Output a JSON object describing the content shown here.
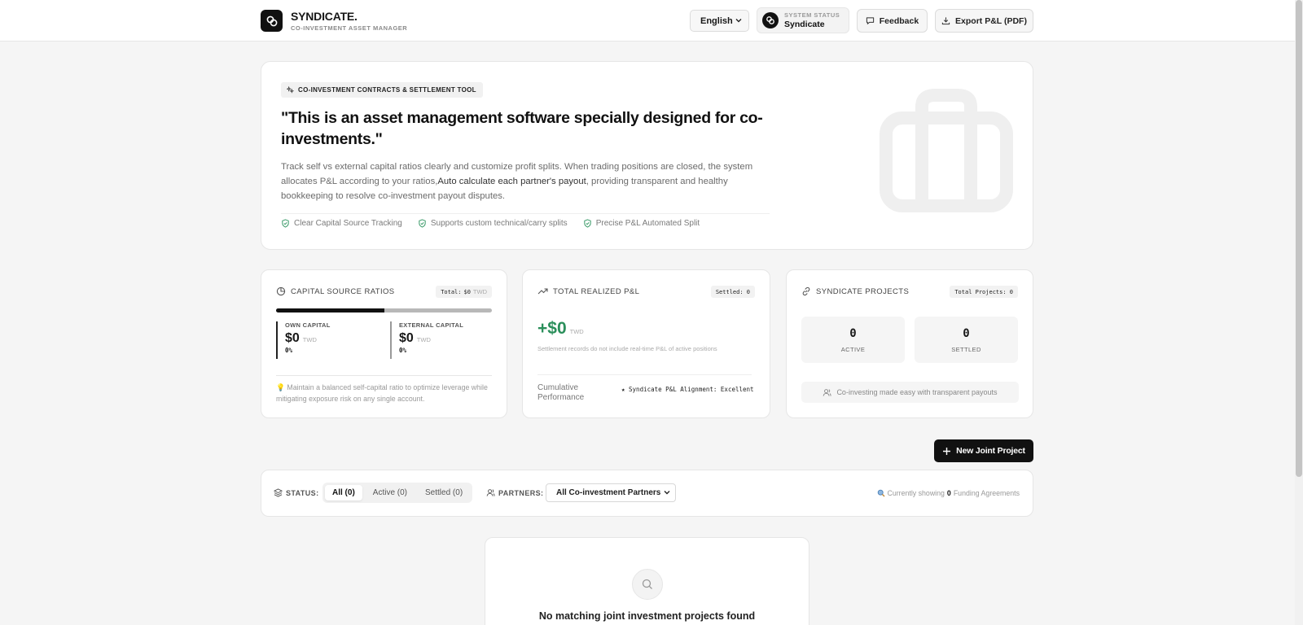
{
  "header": {
    "brand_name": "SYNDICATE.",
    "brand_sub": "CO-INVESTMENT ASSET MANAGER",
    "language": "English",
    "system_status_label": "SYSTEM STATUS",
    "system_status_value": "Syndicate",
    "feedback_label": "Feedback",
    "export_label": "Export P&L (PDF)"
  },
  "hero": {
    "badge": "CO-INVESTMENT CONTRACTS & SETTLEMENT TOOL",
    "title": "\"This is an asset management software specially designed for co-investments.\"",
    "desc_part1": "Track self vs external capital ratios clearly and customize profit splits. When trading positions are closed, the system allocates P&L according to your ratios,",
    "desc_highlight": "Auto calculate each partner's payout",
    "desc_part2": ", providing transparent and healthy bookkeeping to resolve co-investment payout disputes.",
    "features": [
      "Clear Capital Source Tracking",
      "Supports custom technical/carry splits",
      "Precise P&L Automated Split"
    ]
  },
  "capital": {
    "title": "CAPITAL SOURCE RATIOS",
    "pill_label": "Total:",
    "pill_value": "$0",
    "pill_unit": "TWD",
    "own_ratio": 0.5,
    "own_label": "OWN CAPITAL",
    "own_value": "$0",
    "own_unit": "TWD",
    "own_pct": "0%",
    "ext_label": "EXTERNAL CAPITAL",
    "ext_value": "$0",
    "ext_unit": "TWD",
    "ext_pct": "0%",
    "tip": "💡 Maintain a balanced self-capital ratio to optimize leverage while mitigating exposure risk on any single account."
  },
  "pnl": {
    "title": "TOTAL REALIZED P&L",
    "pill": "Settled: 0",
    "value": "+$0",
    "unit": "TWD",
    "note": "Settlement records do not include real-time P&L of active positions",
    "perf_label": "Cumulative Performance",
    "perf_value": "★ Syndicate P&L Alignment: Excellent",
    "color": "#2b8f5b"
  },
  "projects": {
    "title": "SYNDICATE PROJECTS",
    "pill": "Total Projects: 0",
    "active_count": "0",
    "active_label": "ACTIVE",
    "settled_count": "0",
    "settled_label": "SETTLED",
    "footer": "Co-investing made easy with transparent payouts"
  },
  "new_project_label": "New Joint Project",
  "filters": {
    "status_label": "STATUS:",
    "tabs": [
      "All (0)",
      "Active (0)",
      "Settled (0)"
    ],
    "partners_label": "PARTNERS:",
    "partner_select": "All Co-investment Partners",
    "showing_prefix": "Currently showing",
    "showing_count": "0",
    "showing_suffix": "Funding Agreements"
  },
  "empty_text": "No matching joint investment projects found"
}
